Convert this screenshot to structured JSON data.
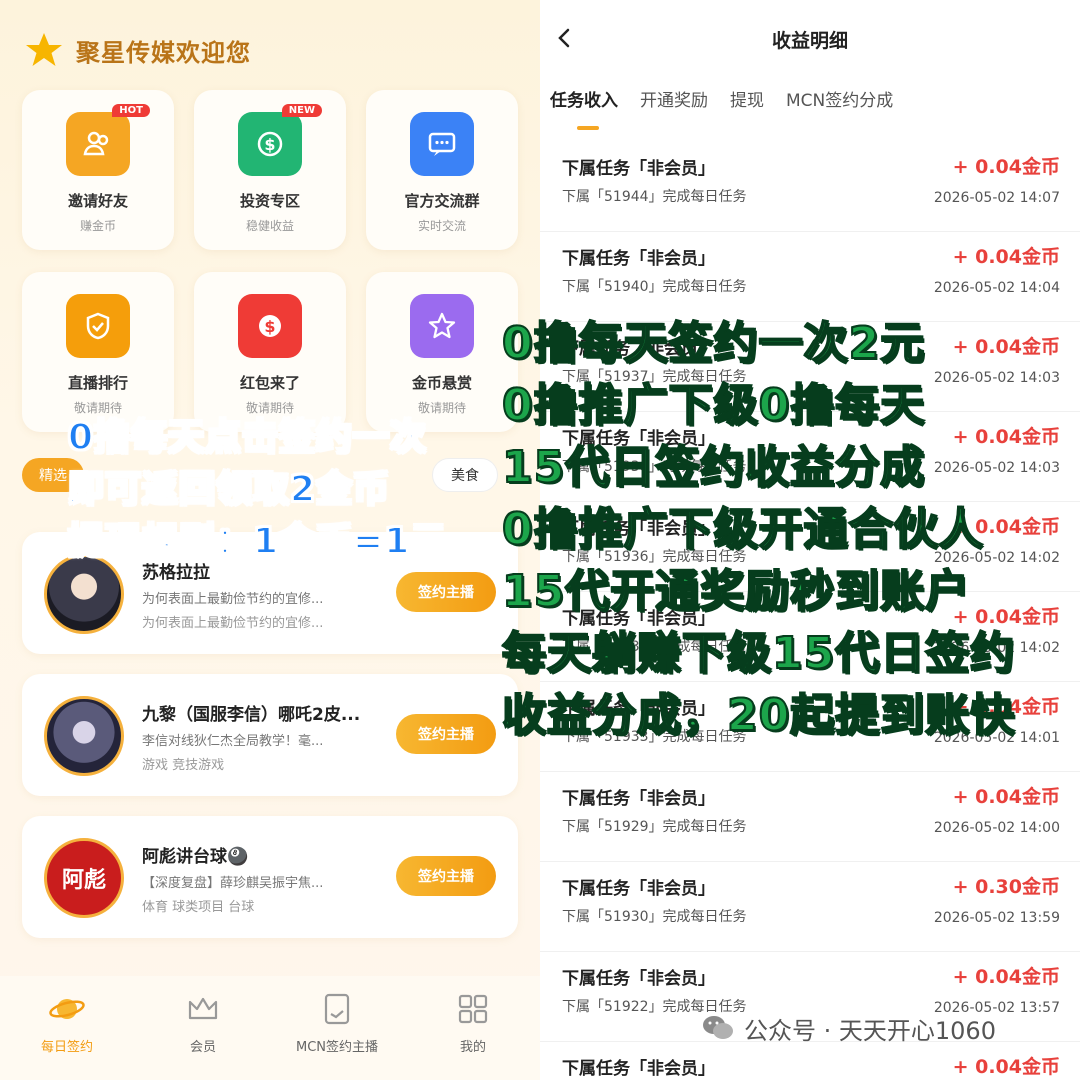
{
  "left": {
    "brand_title": "聚星传媒欢迎您",
    "cards": [
      {
        "name": "邀请好友",
        "sub": "赚金币",
        "badge": "HOT",
        "icon": "users-icon",
        "color": "#f5a623"
      },
      {
        "name": "投资专区",
        "sub": "稳健收益",
        "badge": "NEW",
        "icon": "dollar-coin-icon",
        "color": "#22b573"
      },
      {
        "name": "官方交流群",
        "sub": "实时交流",
        "badge": "",
        "icon": "chat-icon",
        "color": "#3b82f6"
      },
      {
        "name": "直播排行",
        "sub": "敬请期待",
        "badge": "",
        "icon": "check-shield-icon",
        "color": "#f59e0b"
      },
      {
        "name": "红包来了",
        "sub": "敬请期待",
        "badge": "",
        "icon": "red-packet-icon",
        "color": "#ef3b36"
      },
      {
        "name": "金币悬赏",
        "sub": "敬请期待",
        "badge": "",
        "icon": "star-icon",
        "color": "#9b6bef"
      }
    ],
    "chips": {
      "active": "精选",
      "food": "美食"
    },
    "streamers": [
      {
        "name": "苏格拉拉",
        "desc": "为何表面上最勤俭节约的宜修...",
        "tags": "为何表面上最勤俭节约的宜修...",
        "button": "签约主播"
      },
      {
        "name": "九黎（国服李信）哪吒2皮...",
        "desc": "李信对线狄仁杰全局教学！毫...",
        "tags": "游戏  竞技游戏",
        "button": "签约主播"
      },
      {
        "name": "阿彪讲台球🎱",
        "desc": "【深度复盘】薛珍麒吴振宇焦...",
        "tags": "体育  球类项目  台球",
        "button": "签约主播",
        "avatar_text": "阿彪"
      }
    ],
    "nav": [
      {
        "label": "每日签约",
        "icon": "planet-icon"
      },
      {
        "label": "会员",
        "icon": "crown-icon"
      },
      {
        "label": "MCN签约主播",
        "icon": "contract-icon"
      },
      {
        "label": "我的",
        "icon": "grid-icon"
      }
    ]
  },
  "right": {
    "title": "收益明细",
    "tabs": [
      "任务收入",
      "开通奖励",
      "提现",
      "MCN签约分成"
    ],
    "records": [
      {
        "title": "下属任务「非会员」",
        "amount": "+ 0.04金币",
        "desc": "下属「51944」完成每日任务",
        "time": "2026-05-02 14:07"
      },
      {
        "title": "下属任务「非会员」",
        "amount": "+ 0.04金币",
        "desc": "下属「51940」完成每日任务",
        "time": "2026-05-02 14:04"
      },
      {
        "title": "下属任务「非会员」",
        "amount": "+ 0.04金币",
        "desc": "下属「51937」完成每日任务",
        "time": "2026-05-02 14:03"
      },
      {
        "title": "下属任务「非会员」",
        "amount": "+ 0.04金币",
        "desc": "下属「51938」完成每日任务",
        "time": "2026-05-02 14:03"
      },
      {
        "title": "下属任务「非会员」",
        "amount": "+ 0.04金币",
        "desc": "下属「51936」完成每日任务",
        "time": "2026-05-02 14:02"
      },
      {
        "title": "下属任务「非会员」",
        "amount": "+ 0.04金币",
        "desc": "下属「51935」完成每日任务",
        "time": "2026-05-02 14:02"
      },
      {
        "title": "下属任务「非会员」",
        "amount": "+ 0.04金币",
        "desc": "下属「51933」完成每日任务",
        "time": "2026-05-02 14:01"
      },
      {
        "title": "下属任务「非会员」",
        "amount": "+ 0.04金币",
        "desc": "下属「51929」完成每日任务",
        "time": "2026-05-02 14:00"
      },
      {
        "title": "下属任务「非会员」",
        "amount": "+ 0.30金币",
        "desc": "下属「51930」完成每日任务",
        "time": "2026-05-02 13:59"
      },
      {
        "title": "下属任务「非会员」",
        "amount": "+ 0.04金币",
        "desc": "下属「51922」完成每日任务",
        "time": "2026-05-02 13:57"
      },
      {
        "title": "下属任务「非会员」",
        "amount": "+ 0.04金币",
        "desc": "",
        "time": ""
      }
    ]
  },
  "watermark": "公众号 · 天天开心1060",
  "overlay": {
    "blue": [
      "0撸每天点击签约一次",
      "即可返回领取2金币",
      "提现规则：1金币=1元"
    ],
    "green": [
      "0撸每天签约一次2元",
      "0撸推广下级0撸每天",
      "15代日签约收益分成",
      "0撸推广下级开通合伙人",
      "15代开通奖励秒到账户",
      "每天躺赚下级15代日签约",
      "收益分成，20起提到账快"
    ]
  },
  "colors": {
    "accent": "#f5a623",
    "amount": "#e8413c",
    "overlay_blue": "#1f7ff2",
    "overlay_green": "#1ca54b"
  }
}
